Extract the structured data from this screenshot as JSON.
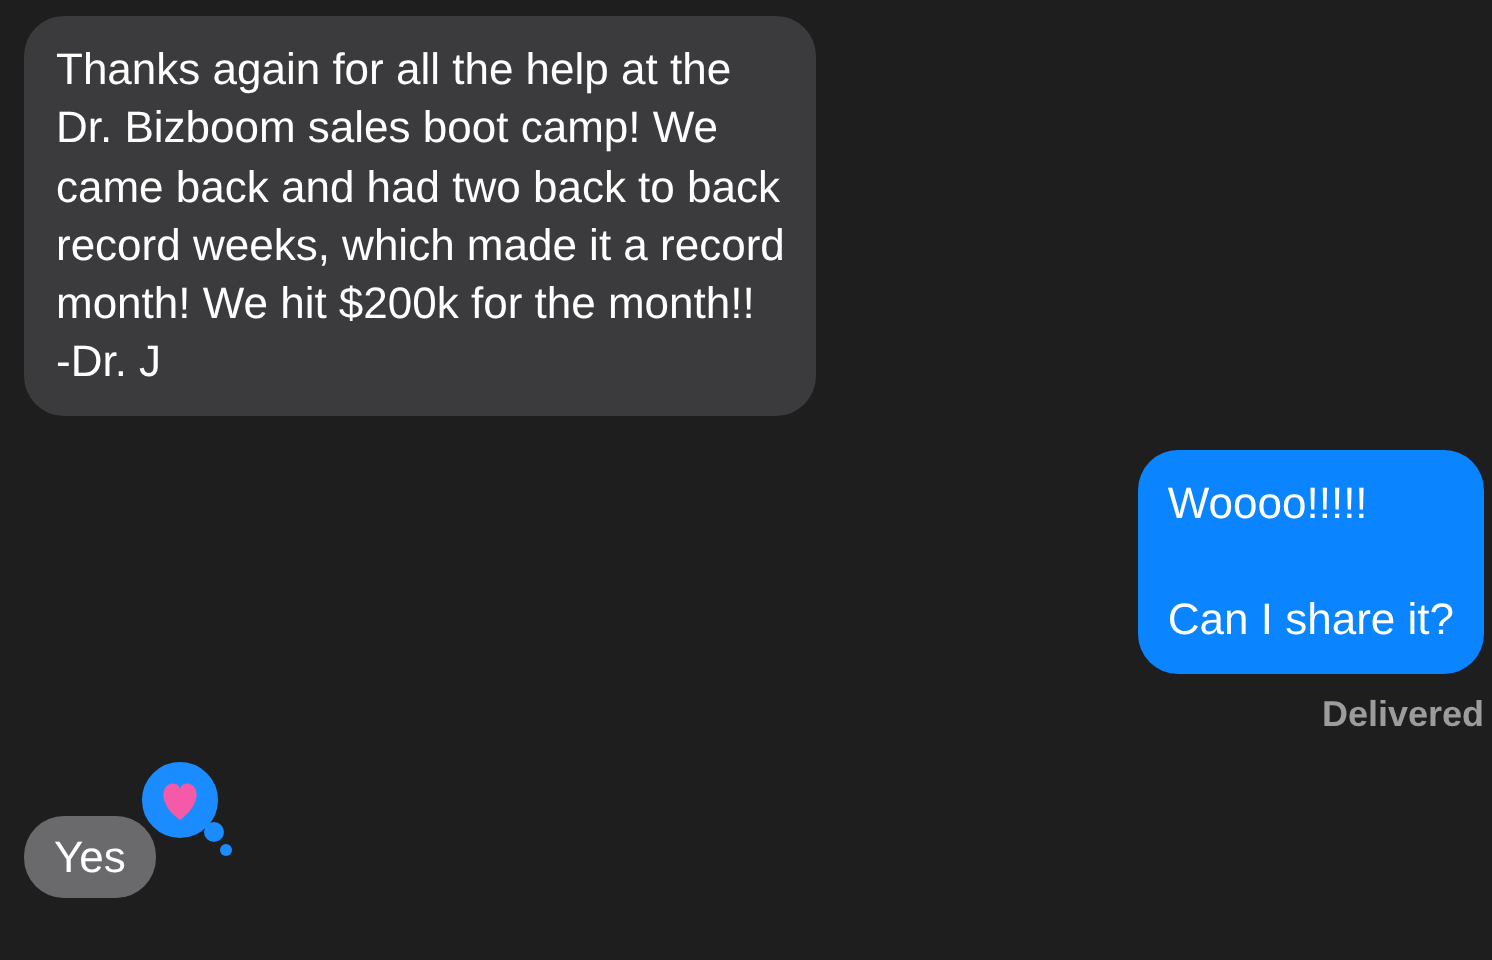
{
  "messages": [
    {
      "kind": "incoming",
      "text": "Thanks again for all the help at the\nDr. Bizboom sales boot camp! We\ncame back and had two back to back\nrecord weeks, which made it a record\nmonth! We hit $200k for the month!!\n-Dr. J"
    },
    {
      "kind": "outgoing",
      "text": "Woooo!!!!!\n\nCan I share it?",
      "status": "Delivered"
    },
    {
      "kind": "incoming",
      "text": "Yes",
      "hearted": true
    }
  ]
}
